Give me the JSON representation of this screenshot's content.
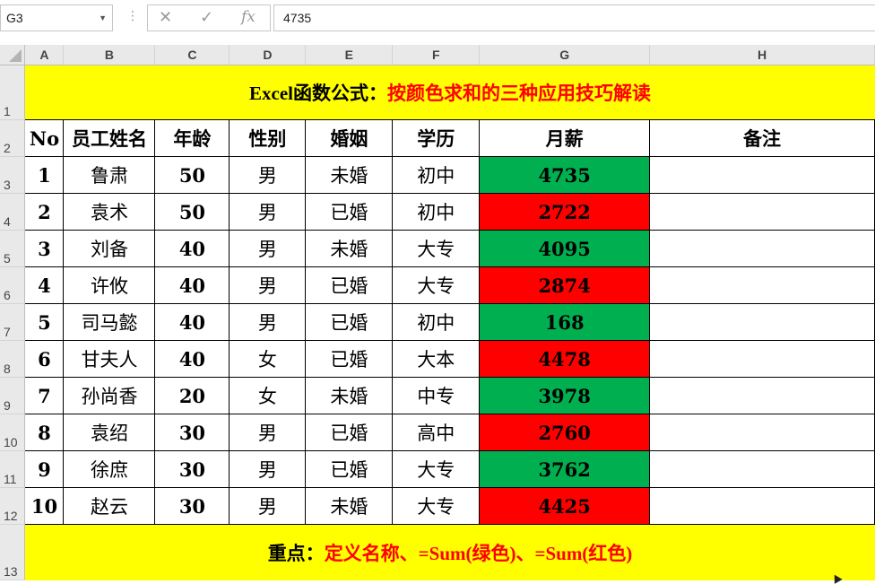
{
  "formula_bar": {
    "name_box": "G3",
    "cancel_icon": "✕",
    "enter_icon": "✓",
    "fx_icon": "fx",
    "formula_value": "4735"
  },
  "columns": [
    "A",
    "B",
    "C",
    "D",
    "E",
    "F",
    "G",
    "H"
  ],
  "row_numbers": [
    "1",
    "2",
    "3",
    "4",
    "5",
    "6",
    "7",
    "8",
    "9",
    "10",
    "11",
    "12",
    "13"
  ],
  "title": {
    "prefix": "Excel函数公式：",
    "highlight": "按颜色求和的三种应用技巧解读"
  },
  "headers": [
    "No",
    "员工姓名",
    "年龄",
    "性别",
    "婚姻",
    "学历",
    "月薪",
    "备注"
  ],
  "rows": [
    {
      "no": "1",
      "name": "鲁肃",
      "age": "50",
      "gender": "男",
      "marriage": "未婚",
      "edu": "初中",
      "salary": "4735",
      "color": "green",
      "note": ""
    },
    {
      "no": "2",
      "name": "袁术",
      "age": "50",
      "gender": "男",
      "marriage": "已婚",
      "edu": "初中",
      "salary": "2722",
      "color": "red",
      "note": ""
    },
    {
      "no": "3",
      "name": "刘备",
      "age": "40",
      "gender": "男",
      "marriage": "未婚",
      "edu": "大专",
      "salary": "4095",
      "color": "green",
      "note": ""
    },
    {
      "no": "4",
      "name": "许攸",
      "age": "40",
      "gender": "男",
      "marriage": "已婚",
      "edu": "大专",
      "salary": "2874",
      "color": "red",
      "note": ""
    },
    {
      "no": "5",
      "name": "司马懿",
      "age": "40",
      "gender": "男",
      "marriage": "已婚",
      "edu": "初中",
      "salary": "168",
      "color": "green",
      "note": ""
    },
    {
      "no": "6",
      "name": "甘夫人",
      "age": "40",
      "gender": "女",
      "marriage": "已婚",
      "edu": "大本",
      "salary": "4478",
      "color": "red",
      "note": ""
    },
    {
      "no": "7",
      "name": "孙尚香",
      "age": "20",
      "gender": "女",
      "marriage": "未婚",
      "edu": "中专",
      "salary": "3978",
      "color": "green",
      "note": ""
    },
    {
      "no": "8",
      "name": "袁绍",
      "age": "30",
      "gender": "男",
      "marriage": "已婚",
      "edu": "高中",
      "salary": "2760",
      "color": "red",
      "note": ""
    },
    {
      "no": "9",
      "name": "徐庶",
      "age": "30",
      "gender": "男",
      "marriage": "已婚",
      "edu": "大专",
      "salary": "3762",
      "color": "green",
      "note": ""
    },
    {
      "no": "10",
      "name": "赵云",
      "age": "30",
      "gender": "男",
      "marriage": "未婚",
      "edu": "大专",
      "salary": "4425",
      "color": "red",
      "note": ""
    }
  ],
  "footer": {
    "prefix": "重点：",
    "highlight": "定义名称、=Sum(绿色)、=Sum(红色)"
  },
  "colors": {
    "green": "#00b050",
    "red": "#ff0000",
    "yellow": "#ffff00",
    "header_bg": "#e9e9e9"
  }
}
